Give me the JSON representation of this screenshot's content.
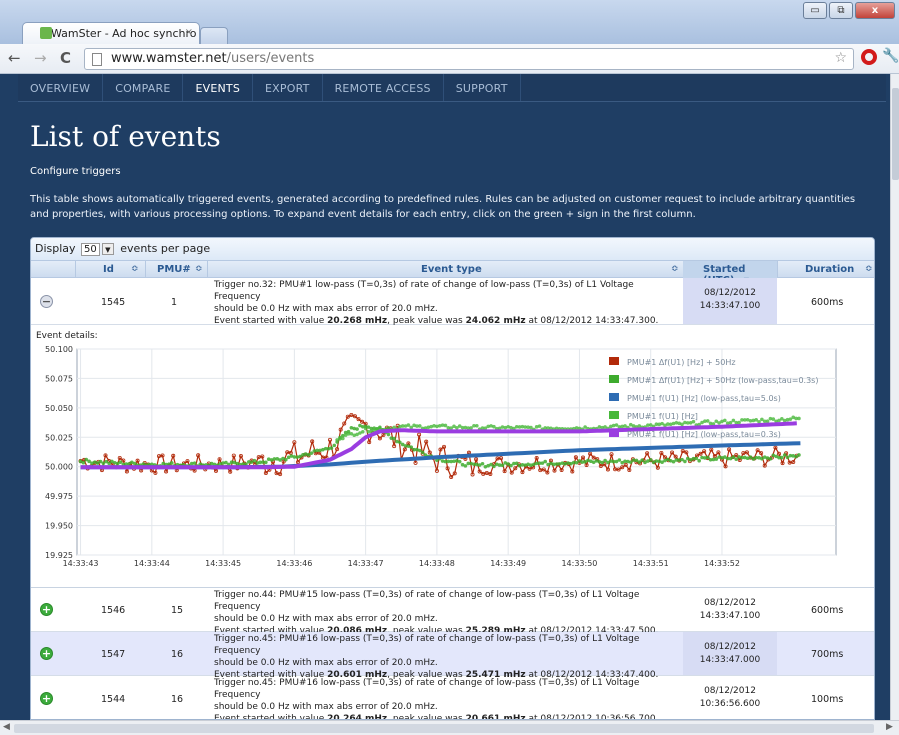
{
  "browser": {
    "tab_title": "WamSter - Ad hoc synchro",
    "tab_close": "×",
    "gmail_label": "M",
    "url_domain": "www.wamster.net",
    "url_path": "/users/events",
    "back": "←",
    "forward": "→",
    "reload": "C",
    "star": "☆",
    "wrench": "🔧",
    "min": "▭",
    "max": "⧉",
    "close": "x"
  },
  "nav": {
    "items": [
      {
        "label": "OVERVIEW",
        "active": false
      },
      {
        "label": "COMPARE",
        "active": false
      },
      {
        "label": "EVENTS",
        "active": true
      },
      {
        "label": "EXPORT",
        "active": false
      },
      {
        "label": "REMOTE ACCESS",
        "active": false
      },
      {
        "label": "SUPPORT",
        "active": false
      }
    ]
  },
  "page": {
    "title": "List of events",
    "configure": "Configure triggers",
    "description": "This table shows automatically triggered events, generated according to predefined rules. Rules can be adjusted on customer request to include arbitrary quantities and properties, with various processing options. To expand event details for each entry, click on the green + sign in the first column."
  },
  "table": {
    "display_prefix": "Display",
    "display_value": "50",
    "display_suffix": "events per page",
    "headers": {
      "id": "Id",
      "pmu": "PMU#",
      "type": "Event type",
      "started": "Started (UTC)",
      "duration": "Duration"
    },
    "sort_icon": "≎",
    "sort_desc_icon": "▾",
    "details_label": "Event details:",
    "rows": [
      {
        "toggle": "−",
        "id": "1545",
        "pmu": "1",
        "line1": "Trigger no.32: PMU#1 low-pass (T=0,3s) of rate of change of low-pass (T=0,3s) of L1 Voltage Frequency",
        "line2": "should be 0.0 Hz with max abs error of 20.0 mHz.",
        "line3a": "Event started with value ",
        "start_value": "20.268 mHz",
        "line3b": ", peak value was ",
        "peak_value": "24.062 mHz",
        "line3c": " at 08/12/2012 14:33:47.300.",
        "date": "08/12/2012",
        "time": "14:33:47.100",
        "duration": "600ms"
      },
      {
        "toggle": "+",
        "id": "1546",
        "pmu": "15",
        "line1": "Trigger no.44: PMU#15 low-pass (T=0,3s) of rate of change of low-pass (T=0,3s) of L1 Voltage Frequency",
        "line2": "should be 0.0 Hz with max abs error of 20.0 mHz.",
        "line3a": "Event started with value ",
        "start_value": "20.086 mHz",
        "line3b": ", peak value was ",
        "peak_value": "25.289 mHz",
        "line3c": " at 08/12/2012 14:33:47.500.",
        "date": "08/12/2012",
        "time": "14:33:47.100",
        "duration": "600ms"
      },
      {
        "toggle": "+",
        "id": "1547",
        "pmu": "16",
        "line1": "Trigger no.45: PMU#16 low-pass (T=0,3s) of rate of change of low-pass (T=0,3s) of L1 Voltage Frequency",
        "line2": "should be 0.0 Hz with max abs error of 20.0 mHz.",
        "line3a": "Event started with value ",
        "start_value": "20.601 mHz",
        "line3b": ", peak value was ",
        "peak_value": "25.471 mHz",
        "line3c": " at 08/12/2012 14:33:47.400.",
        "date": "08/12/2012",
        "time": "14:33:47.000",
        "duration": "700ms"
      },
      {
        "toggle": "+",
        "id": "1544",
        "pmu": "16",
        "line1": "Trigger no.45: PMU#16 low-pass (T=0,3s) of rate of change of low-pass (T=0,3s) of L1 Voltage Frequency",
        "line2": "should be 0.0 Hz with max abs error of 20.0 mHz.",
        "line3a": "Event started with value ",
        "start_value": "20.264 mHz",
        "line3b": ", peak value was ",
        "peak_value": "20.661 mHz",
        "line3c": " at 08/12/2012 10:36:56.700.",
        "date": "08/12/2012",
        "time": "10:36:56.600",
        "duration": "100ms"
      }
    ]
  },
  "chart_data": {
    "type": "line",
    "ylim": [
      49.925,
      50.1
    ],
    "yticks": [
      "50.100",
      "50.075",
      "50.050",
      "50.025",
      "50.000",
      "49.975",
      "49.950",
      "49.925"
    ],
    "ytick_labels": [
      "50.100",
      "50.075",
      "50.050",
      "50.025",
      "50.000",
      "49.975",
      "19.950",
      "19.925"
    ],
    "xticks": [
      "14:33:43",
      "14:33:44",
      "14:33:45",
      "14:33:46",
      "14:33:47",
      "14:33:48",
      "14:33:49",
      "14:33:50",
      "14:33:51",
      "14:33:52"
    ],
    "legend_position": "top-right",
    "series": [
      {
        "name": "PMU#1 Δf(U1) [Hz] + 50Hz",
        "color": "#b22a0a",
        "kind": "noisy"
      },
      {
        "name": "PMU#1 Δf(U1) [Hz] + 50Hz (low-pass,tau=0.3s)",
        "color": "#3eab2e",
        "kind": "dots"
      },
      {
        "name": "PMU#1 f(U1) [Hz] (low-pass,tau=5.0s)",
        "color": "#2e6cb3",
        "kind": "thick"
      },
      {
        "name": "PMU#1 f(U1) [Hz]",
        "color": "#47b83a",
        "kind": "dots"
      },
      {
        "name": "PMU#1 f(U1) [Hz] (low-pass,tau=0.3s)",
        "color": "#9a3de0",
        "kind": "thick"
      }
    ],
    "curves": {
      "lp5": {
        "x": [
          0,
          1,
          2,
          2.8,
          3.5,
          4.2,
          5,
          6,
          7,
          8,
          9,
          10.1
        ],
        "y": [
          49.9995,
          49.9995,
          49.9995,
          50.0,
          50.002,
          50.005,
          50.008,
          50.011,
          50.014,
          50.016,
          50.018,
          50.02
        ]
      },
      "lp03": {
        "x": [
          0,
          1,
          2,
          2.5,
          3,
          3.5,
          3.8,
          4.0,
          4.2,
          4.5,
          5,
          6,
          7,
          8,
          9,
          10.1
        ],
        "y": [
          49.9995,
          49.9995,
          49.9995,
          49.9995,
          50.0,
          50.006,
          50.015,
          50.025,
          50.03,
          50.031,
          50.03,
          50.03,
          50.03,
          50.032,
          50.034,
          50.037
        ]
      },
      "dots": {
        "x": [
          0,
          0.5,
          1,
          2,
          2.5,
          3,
          3.5,
          3.8,
          4.0,
          4.2,
          4.5,
          5,
          5.5,
          6,
          7,
          8,
          9,
          10.1
        ],
        "y": [
          50.005,
          50.003,
          50.002,
          50.002,
          50.004,
          50.008,
          50.016,
          50.032,
          50.035,
          50.032,
          50.02,
          50.007,
          50.001,
          50.002,
          50.004,
          50.005,
          50.007,
          50.009
        ]
      },
      "green2": {
        "x": [
          3.6,
          4.0,
          4.5,
          5,
          6,
          7,
          8,
          9,
          10.1
        ],
        "y": [
          50.024,
          50.031,
          50.034,
          50.034,
          50.033,
          50.033,
          50.035,
          50.038,
          50.041
        ]
      }
    }
  }
}
